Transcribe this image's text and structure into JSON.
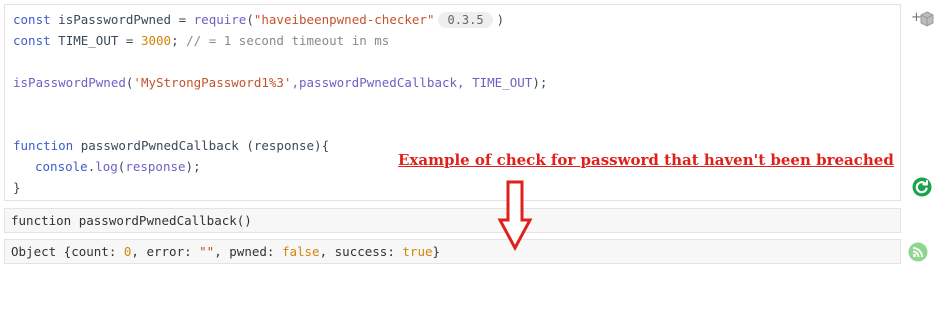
{
  "code": {
    "line1": {
      "kw": "const",
      "name": " isPasswordPwned = ",
      "fn": "require",
      "open": "(",
      "str": "\"haveibeenpwned-checker\"",
      "badge": "0.3.5",
      "close": ")"
    },
    "line2": {
      "kw": "const",
      "name": " TIME_OUT = ",
      "num": "3000",
      "semi": "; ",
      "comment": "// = 1 second timeout in ms"
    },
    "line3": {
      "fn": "isPasswordPwned",
      "open": "(",
      "str": "'MyStrongPassword1%3'",
      "rest": ",passwordPwnedCallback, ",
      "const": "TIME_OUT",
      "close": ");"
    },
    "line4": {
      "kw": "function",
      "name": " passwordPwnedCallback ",
      "params": "(response){"
    },
    "line5": {
      "obj": "console",
      "dot": ".",
      "method": "log",
      "open": "(",
      "arg": "response",
      "close": ");"
    },
    "line6": {
      "brace": "}"
    }
  },
  "output1": {
    "text": "function passwordPwnedCallback()"
  },
  "output2": {
    "prefix": "Object {count: ",
    "count": "0",
    "error_label": ", error: ",
    "error_val": "\"\"",
    "pwned_label": ", pwned: ",
    "pwned_val": "false",
    "success_label": ", success: ",
    "success_val": "true",
    "suffix": "}"
  },
  "annotation": {
    "text": "Example of check for password that haven't been breached"
  },
  "side": {
    "add_label": "+"
  },
  "colors": {
    "annotation": "#e0201a",
    "run_icon": "#1aa34a",
    "feed_icon": "#8fd68f"
  }
}
